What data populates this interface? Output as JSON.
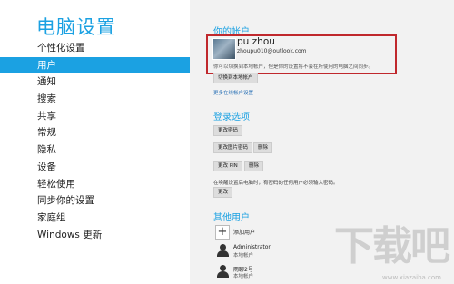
{
  "sidebar": {
    "title": "电脑设置",
    "items": [
      {
        "label": "个性化设置"
      },
      {
        "label": "用户"
      },
      {
        "label": "通知"
      },
      {
        "label": "搜索"
      },
      {
        "label": "共享"
      },
      {
        "label": "常规"
      },
      {
        "label": "隐私"
      },
      {
        "label": "设备"
      },
      {
        "label": "轻松使用"
      },
      {
        "label": "同步你的设置"
      },
      {
        "label": "家庭组"
      },
      {
        "label": "Windows 更新"
      }
    ],
    "selected_index": 1
  },
  "account": {
    "section_title": "你的帐户",
    "name": "pu zhou",
    "email": "zhoupu010@outlook.com",
    "note": "你可以切换到本地帐户，但是你的设置将不会在所使用的电脑之间同步。",
    "switch_button": "切换到本地帐户",
    "more_link": "更多在线帐户设置"
  },
  "signin": {
    "section_title": "登录选项",
    "change_password": "更改密码",
    "change_picture_password": "更改图片密码",
    "remove1": "删除",
    "change_pin": "更改 PIN",
    "remove2": "删除",
    "policy_text": "在唤醒设置后电脑时，有密码的任何用户必须输入密码。",
    "change": "更改"
  },
  "others": {
    "section_title": "其他用户",
    "add_user": "添加用户",
    "users": [
      {
        "name": "Administrator",
        "type": "本地帐户"
      },
      {
        "name": "雨聊2号",
        "type": "本地帐户"
      }
    ]
  },
  "watermark": {
    "text": "下载吧",
    "url": "www.xiazaiba.com"
  },
  "colors": {
    "accent": "#1ba1e2",
    "highlight_box": "#c0282d"
  }
}
